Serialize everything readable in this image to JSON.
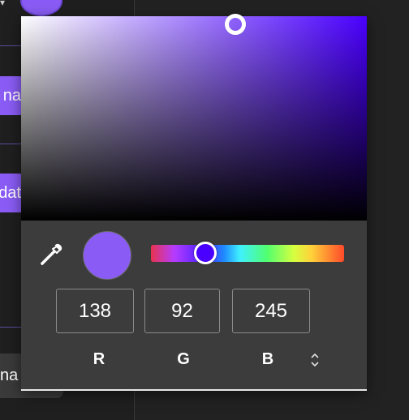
{
  "background": {
    "button_a_text": "na",
    "button_b_text": "dat",
    "button_c_text": "na"
  },
  "color": {
    "hex": "#8a5cf5",
    "hue_hex": "#4a00ff",
    "hue_fraction": 0.28,
    "saturation": 0.62,
    "value": 0.96
  },
  "picker": {
    "r_value": "138",
    "g_value": "92",
    "b_value": "245",
    "r_label": "R",
    "g_label": "G",
    "b_label": "B"
  },
  "icons": {
    "eyedropper": "eyedropper-icon",
    "mode_toggle": "chevron-up-down-icon"
  }
}
